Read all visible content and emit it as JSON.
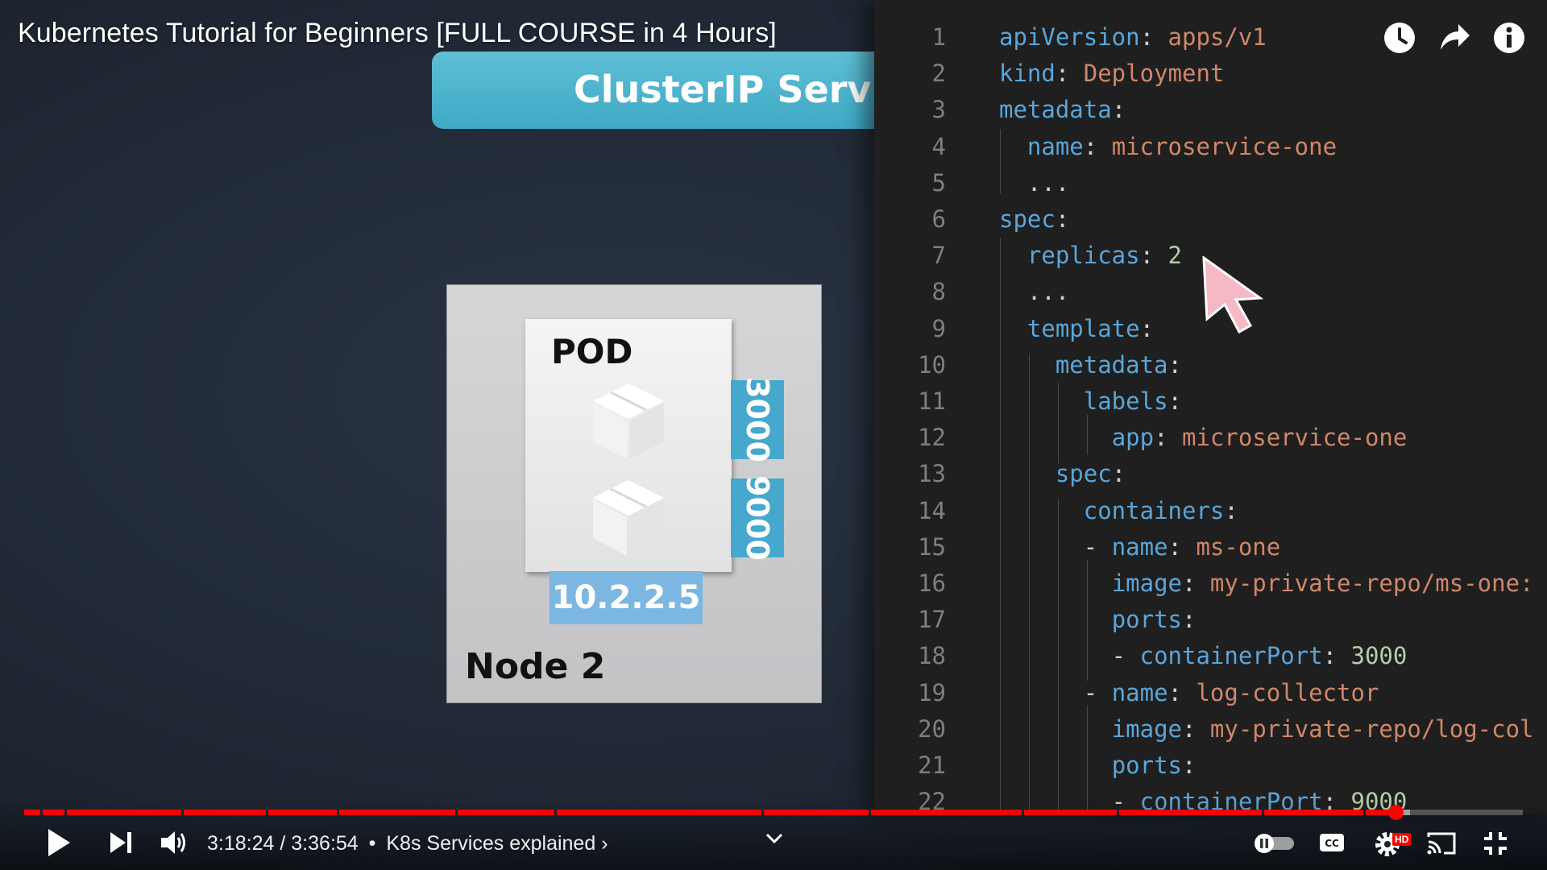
{
  "video": {
    "title": "Kubernetes Tutorial for Beginners [FULL COURSE in 4 Hours]"
  },
  "slide": {
    "banner": "ClusterIP Services",
    "node_label": "Node 2",
    "pod_label": "POD",
    "port_top": "3000",
    "port_bottom": "9000",
    "pod_ip": "10.2.2.5"
  },
  "code": {
    "lines": [
      {
        "num": "1",
        "parts": [
          [
            "k",
            "apiVersion"
          ],
          [
            "p",
            ": "
          ],
          [
            "s",
            "apps/v1"
          ]
        ]
      },
      {
        "num": "2",
        "parts": [
          [
            "k",
            "kind"
          ],
          [
            "p",
            ": "
          ],
          [
            "s",
            "Deployment"
          ]
        ]
      },
      {
        "num": "3",
        "parts": [
          [
            "k",
            "metadata"
          ],
          [
            "p",
            ":"
          ]
        ]
      },
      {
        "num": "4",
        "parts": [
          [
            "p",
            "  "
          ],
          [
            "k",
            "name"
          ],
          [
            "p",
            ": "
          ],
          [
            "s",
            "microservice-one"
          ]
        ]
      },
      {
        "num": "5",
        "parts": [
          [
            "p",
            "  ..."
          ]
        ]
      },
      {
        "num": "6",
        "parts": [
          [
            "k",
            "spec"
          ],
          [
            "p",
            ":"
          ]
        ]
      },
      {
        "num": "7",
        "parts": [
          [
            "p",
            "  "
          ],
          [
            "k",
            "replicas"
          ],
          [
            "p",
            ": "
          ],
          [
            "n",
            "2"
          ]
        ]
      },
      {
        "num": "8",
        "parts": [
          [
            "p",
            "  ..."
          ]
        ]
      },
      {
        "num": "9",
        "parts": [
          [
            "p",
            "  "
          ],
          [
            "k",
            "template"
          ],
          [
            "p",
            ":"
          ]
        ]
      },
      {
        "num": "10",
        "parts": [
          [
            "p",
            "    "
          ],
          [
            "k",
            "metadata"
          ],
          [
            "p",
            ":"
          ]
        ]
      },
      {
        "num": "11",
        "parts": [
          [
            "p",
            "      "
          ],
          [
            "k",
            "labels"
          ],
          [
            "p",
            ":"
          ]
        ]
      },
      {
        "num": "12",
        "parts": [
          [
            "p",
            "        "
          ],
          [
            "k",
            "app"
          ],
          [
            "p",
            ": "
          ],
          [
            "s",
            "microservice-one"
          ]
        ]
      },
      {
        "num": "13",
        "parts": [
          [
            "p",
            "    "
          ],
          [
            "k",
            "spec"
          ],
          [
            "p",
            ":"
          ]
        ]
      },
      {
        "num": "14",
        "parts": [
          [
            "p",
            "      "
          ],
          [
            "k",
            "containers"
          ],
          [
            "p",
            ":"
          ]
        ]
      },
      {
        "num": "15",
        "parts": [
          [
            "p",
            "      - "
          ],
          [
            "k",
            "name"
          ],
          [
            "p",
            ": "
          ],
          [
            "s",
            "ms-one"
          ]
        ]
      },
      {
        "num": "16",
        "parts": [
          [
            "p",
            "        "
          ],
          [
            "k",
            "image"
          ],
          [
            "p",
            ": "
          ],
          [
            "s",
            "my-private-repo/ms-one:"
          ]
        ]
      },
      {
        "num": "17",
        "parts": [
          [
            "p",
            "        "
          ],
          [
            "k",
            "ports"
          ],
          [
            "p",
            ":"
          ]
        ]
      },
      {
        "num": "18",
        "parts": [
          [
            "p",
            "        - "
          ],
          [
            "k",
            "containerPort"
          ],
          [
            "p",
            ": "
          ],
          [
            "n",
            "3000"
          ]
        ]
      },
      {
        "num": "19",
        "parts": [
          [
            "p",
            "      - "
          ],
          [
            "k",
            "name"
          ],
          [
            "p",
            ": "
          ],
          [
            "s",
            "log-collector"
          ]
        ]
      },
      {
        "num": "20",
        "parts": [
          [
            "p",
            "        "
          ],
          [
            "k",
            "image"
          ],
          [
            "p",
            ": "
          ],
          [
            "s",
            "my-private-repo/log-col"
          ]
        ]
      },
      {
        "num": "21",
        "parts": [
          [
            "p",
            "        "
          ],
          [
            "k",
            "ports"
          ],
          [
            "p",
            ":"
          ]
        ]
      },
      {
        "num": "22",
        "parts": [
          [
            "p",
            "        - "
          ],
          [
            "k",
            "containerPort"
          ],
          [
            "p",
            ": "
          ],
          [
            "n",
            "9000"
          ]
        ]
      }
    ]
  },
  "player": {
    "current_time": "3:18:24",
    "duration": "3:36:54",
    "chapter": "K8s Services explained",
    "chapter_chevron": "›",
    "hd_badge": "HD",
    "progress_fraction": 0.915,
    "buffered_fraction": 0.925,
    "colors": {
      "played": "#ff0000",
      "accent_blue": "#45a8cc"
    }
  },
  "icons": {
    "top_right": [
      "clock-icon",
      "share-icon",
      "info-icon"
    ],
    "bottom_left": [
      "play-icon",
      "next-icon",
      "volume-icon"
    ],
    "bottom_right": [
      "autoplay-toggle-icon",
      "captions-icon",
      "settings-icon",
      "cast-icon",
      "exit-fullscreen-icon"
    ]
  }
}
